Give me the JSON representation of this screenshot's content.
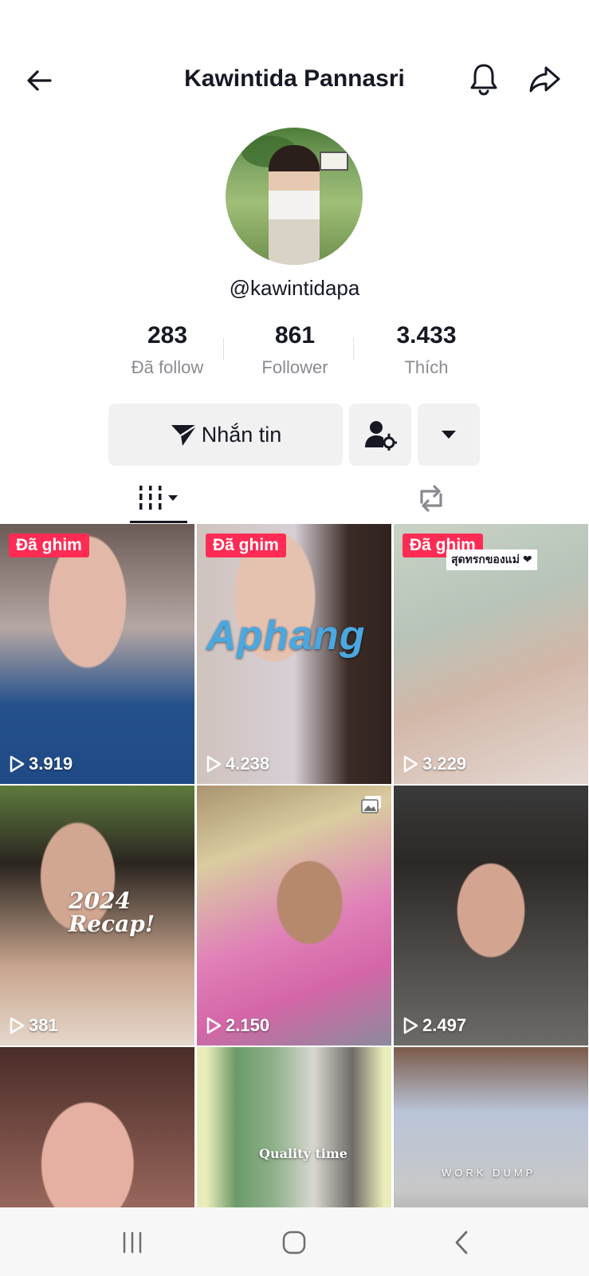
{
  "header": {
    "title": "Kawintida Pannasri",
    "back_icon": "arrow-left-icon",
    "bell_icon": "bell-icon",
    "share_icon": "share-icon"
  },
  "profile": {
    "handle": "@kawintidapa",
    "stats": [
      {
        "value": "283",
        "label": "Đã follow"
      },
      {
        "value": "861",
        "label": "Follower"
      },
      {
        "value": "3.433",
        "label": "Thích"
      }
    ]
  },
  "actions": {
    "message_label": "Nhắn tin",
    "message_icon": "send-icon",
    "friend_icon": "user-settings-icon",
    "more_icon": "caret-down-icon"
  },
  "tabs": {
    "videos_icon": "grid-icon",
    "repost_icon": "repost-icon"
  },
  "videos": [
    {
      "pinned": "Đã ghim",
      "views": "3.919"
    },
    {
      "pinned": "Đã ghim",
      "views": "4.238",
      "overlay": "Aphang"
    },
    {
      "pinned": "Đã ghim",
      "views": "3.229",
      "overlay": "สุดทรกของแม่ ❤"
    },
    {
      "views": "381",
      "overlay": "2024 Recap!"
    },
    {
      "views": "2.150"
    },
    {
      "views": "2.497"
    },
    {},
    {
      "overlay": "Quality time"
    },
    {
      "overlay": "WORK DUMP"
    }
  ],
  "colors": {
    "pin_badge": "#fe2c55",
    "text_primary": "#161823",
    "text_secondary": "#8a8b91",
    "button_bg": "#f1f1f2"
  }
}
